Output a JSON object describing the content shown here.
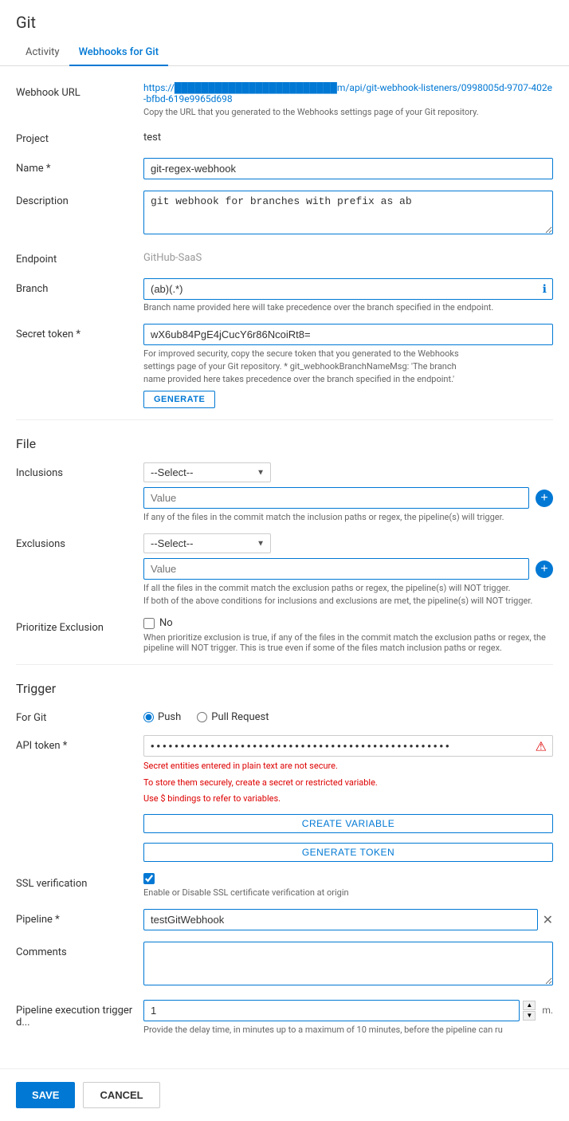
{
  "page": {
    "title": "Git",
    "tabs": [
      {
        "id": "activity",
        "label": "Activity"
      },
      {
        "id": "webhooks",
        "label": "Webhooks for Git",
        "active": true
      }
    ]
  },
  "form": {
    "webhook_url_label": "Webhook URL",
    "webhook_url_value": "https://████████████████████████m/api/git-webhook-listeners/0998005d-9707-402e-bfbd-619e9965d698",
    "webhook_url_hint": "Copy the URL that you generated to the Webhooks settings page of your Git repository.",
    "project_label": "Project",
    "project_value": "test",
    "name_label": "Name *",
    "name_value": "git-regex-webhook",
    "description_label": "Description",
    "description_value": "git webhook for branches with prefix as ab",
    "endpoint_label": "Endpoint",
    "endpoint_value": "GitHub-SaaS",
    "branch_label": "Branch",
    "branch_value": "(ab)(.*)",
    "branch_hint": "Branch name provided here will take precedence over the branch specified in the endpoint.",
    "secret_token_label": "Secret token *",
    "secret_token_value": "wX6ub84PgE4jCucY6r86NcoiRt8=",
    "secret_token_hint1": "For improved security, copy the secure token that you generated to the Webhooks",
    "secret_token_hint2": "settings page of your Git repository. * git_webhookBranchNameMsg: 'The branch",
    "secret_token_hint3": "name provided here takes precedence over the branch specified in the endpoint.'",
    "generate_btn": "GENERATE",
    "file_section": "File",
    "inclusions_label": "Inclusions",
    "inclusions_select_default": "--Select--",
    "inclusions_value_placeholder": "Value",
    "inclusions_hint": "If any of the files in the commit match the inclusion paths or regex, the pipeline(s) will trigger.",
    "exclusions_label": "Exclusions",
    "exclusions_select_default": "--Select--",
    "exclusions_value_placeholder": "Value",
    "exclusions_hint1": "If all the files in the commit match the exclusion paths or regex, the pipeline(s) will NOT trigger.",
    "exclusions_hint2": "If both of the above conditions for inclusions and exclusions are met, the pipeline(s) will NOT trigger.",
    "prioritize_label": "Prioritize Exclusion",
    "prioritize_checkbox_label": "No",
    "prioritize_hint": "When prioritize exclusion is true, if any of the files in the commit match the exclusion paths or regex, the pipeline will NOT trigger. This is true even if some of the files match inclusion paths or regex.",
    "trigger_section": "Trigger",
    "for_git_label": "For Git",
    "push_label": "Push",
    "pull_request_label": "Pull Request",
    "api_token_label": "API token *",
    "api_token_dots": "••••••••••••••••••••••••••••••••••••••••••••••••••",
    "api_token_error1": "Secret entities entered in plain text are not secure.",
    "api_token_error2": "To store them securely, create a secret or restricted variable.",
    "api_token_error3": "Use $ bindings to refer to variables.",
    "create_variable_btn": "CREATE VARIABLE",
    "generate_token_btn": "GENERATE TOKEN",
    "ssl_label": "SSL verification",
    "ssl_hint": "Enable or Disable SSL certificate verification at origin",
    "pipeline_label": "Pipeline *",
    "pipeline_value": "testGitWebhook",
    "comments_label": "Comments",
    "comments_value": "",
    "pipeline_delay_label": "Pipeline execution trigger d...",
    "pipeline_delay_value": "1",
    "pipeline_delay_unit": "m.",
    "pipeline_delay_hint": "Provide the delay time, in minutes up to a maximum of 10 minutes, before the pipeline can ru",
    "save_btn": "SAVE",
    "cancel_btn": "CANCEL"
  }
}
